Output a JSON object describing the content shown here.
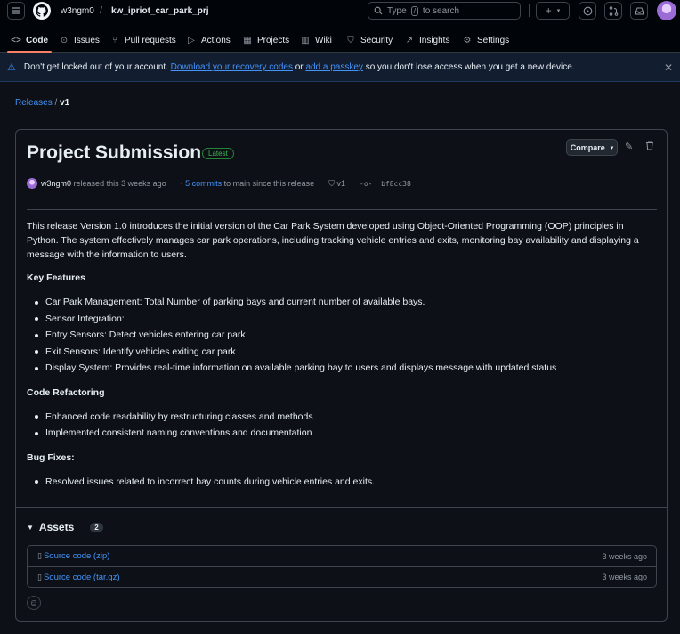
{
  "header": {
    "owner": "w3ngm0",
    "repo": "kw_ipriot_car_park_prj",
    "search_prefix": "Type",
    "search_key": "/",
    "search_suffix": "to search"
  },
  "tabs": [
    {
      "label": "Code",
      "icon": "code-icon"
    },
    {
      "label": "Issues",
      "icon": "issue-icon"
    },
    {
      "label": "Pull requests",
      "icon": "pull-request-icon"
    },
    {
      "label": "Actions",
      "icon": "play-icon"
    },
    {
      "label": "Projects",
      "icon": "table-icon"
    },
    {
      "label": "Wiki",
      "icon": "book-icon"
    },
    {
      "label": "Security",
      "icon": "shield-icon"
    },
    {
      "label": "Insights",
      "icon": "graph-icon"
    },
    {
      "label": "Settings",
      "icon": "gear-icon"
    }
  ],
  "banner": {
    "text_start": "Don't get locked out of your account.",
    "link1": "Download your recovery codes",
    "or": "or",
    "link2": "add a passkey",
    "text_end": "so you don't lose access when you get a new device."
  },
  "breadcrumb": {
    "parent": "Releases",
    "separator": "/",
    "current": "v1"
  },
  "release": {
    "title": "Project Submission",
    "badge": "Latest",
    "compare_label": "Compare",
    "author": "w3ngm0",
    "released_text": "released this 3 weeks ago",
    "commits_link": "5 commits",
    "commits_suffix": "to main since this release",
    "tag": "v1",
    "sha": "bf8cc38",
    "intro": "This release Version 1.0 introduces the initial version of the Car Park System developed using Object-Oriented Programming (OOP) principles in Python. The system effectively manages car park operations, including tracking vehicle entries and exits, monitoring bay availability and displaying a message with the information to users.",
    "sections": [
      {
        "heading": "Key Features",
        "items": [
          "Car Park Management: Total Number of parking bays and current number of available bays.",
          "Sensor Integration:",
          "Entry Sensors: Detect vehicles entering car park",
          "Exit Sensors: Identify vehicles exiting car park",
          "Display System: Provides real-time information on available parking bay to users and displays message with updated status"
        ]
      },
      {
        "heading": "Code Refactoring",
        "items": [
          "Enhanced code readability by restructuring classes and methods",
          "Implemented consistent naming conventions and documentation"
        ]
      },
      {
        "heading": "Bug Fixes:",
        "items": [
          "Resolved issues related to incorrect bay counts during vehicle entries and exits."
        ]
      }
    ]
  },
  "assets": {
    "heading": "Assets",
    "count": "2",
    "items": [
      {
        "name": "Source code (zip)",
        "when": "3 weeks ago"
      },
      {
        "name": "Source code (tar.gz)",
        "when": "3 weeks ago"
      }
    ]
  },
  "colors": {
    "accent": "#4493f8",
    "tab_underline": "#f78166",
    "latest": "#3fb950",
    "background": "#0d1117"
  }
}
